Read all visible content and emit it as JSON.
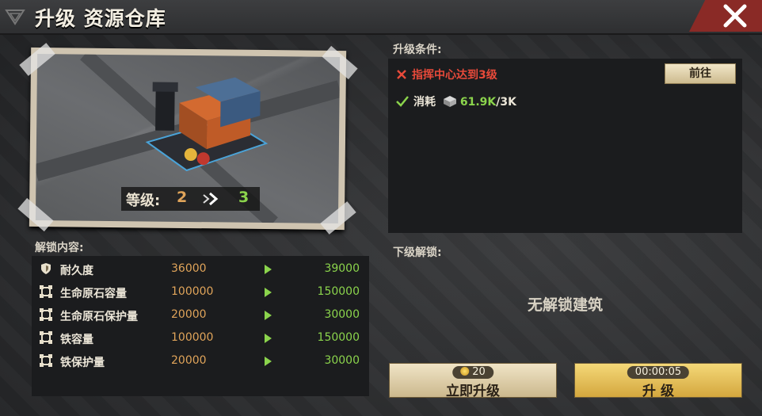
{
  "window": {
    "title": "升级 资源仓库"
  },
  "level": {
    "label": "等级:",
    "current": "2",
    "next": "3"
  },
  "unlock": {
    "heading": "解锁内容:",
    "rows": [
      {
        "icon": "shield-icon",
        "name": "耐久度",
        "current": "36000",
        "next": "39000"
      },
      {
        "icon": "capacity-icon",
        "name": "生命原石容量",
        "current": "100000",
        "next": "150000"
      },
      {
        "icon": "capacity-icon",
        "name": "生命原石保护量",
        "current": "20000",
        "next": "30000"
      },
      {
        "icon": "capacity-icon",
        "name": "铁容量",
        "current": "100000",
        "next": "150000"
      },
      {
        "icon": "capacity-icon",
        "name": "铁保护量",
        "current": "20000",
        "next": "30000"
      }
    ]
  },
  "conditions": {
    "heading": "升级条件:",
    "req1": "指挥中心达到3级",
    "req2_label": "消耗",
    "req2_have": "61.9K",
    "req2_need": "/3K",
    "goto_label": "前往"
  },
  "next_unlock": {
    "heading": "下级解锁:",
    "text": "无解锁建筑"
  },
  "buttons": {
    "instant": {
      "cost": "20",
      "label": "立即升级"
    },
    "upgrade": {
      "time": "00:00:05",
      "label": "升 级"
    }
  },
  "colors": {
    "accent_green": "#8bd44c",
    "accent_orange": "#e0a45a",
    "error_red": "#e84a3a"
  }
}
